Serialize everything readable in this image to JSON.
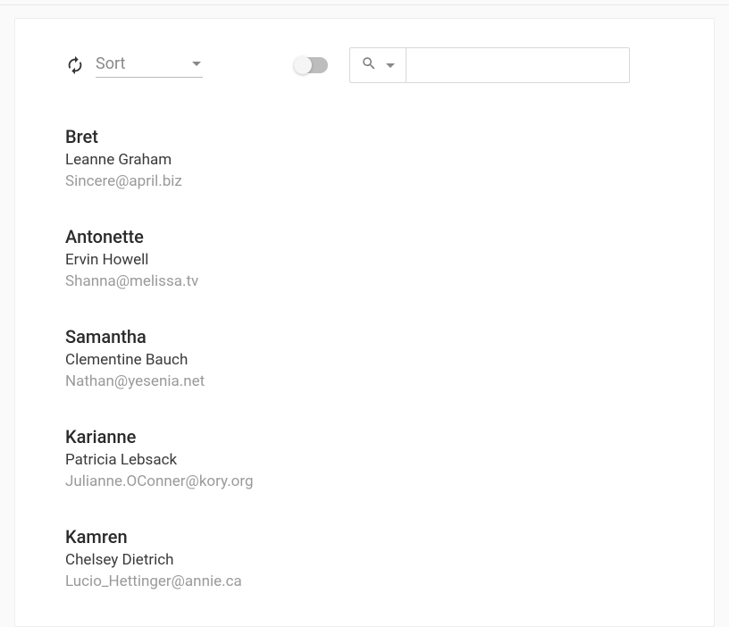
{
  "toolbar": {
    "sort_label": "Sort",
    "search_value": ""
  },
  "users": [
    {
      "username": "Bret",
      "name": "Leanne Graham",
      "email": "Sincere@april.biz"
    },
    {
      "username": "Antonette",
      "name": "Ervin Howell",
      "email": "Shanna@melissa.tv"
    },
    {
      "username": "Samantha",
      "name": "Clementine Bauch",
      "email": "Nathan@yesenia.net"
    },
    {
      "username": "Karianne",
      "name": "Patricia Lebsack",
      "email": "Julianne.OConner@kory.org"
    },
    {
      "username": "Kamren",
      "name": "Chelsey Dietrich",
      "email": "Lucio_Hettinger@annie.ca"
    }
  ]
}
